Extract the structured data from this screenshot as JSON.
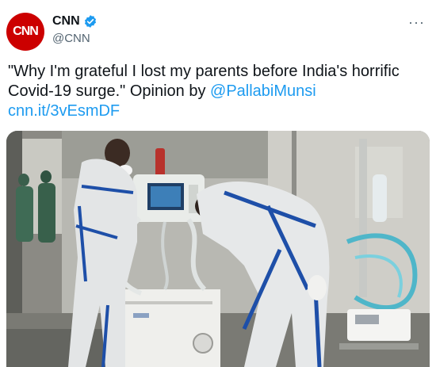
{
  "author": {
    "avatar_text": "CNN",
    "display_name": "CNN",
    "handle": "@CNN",
    "verified_icon": "verified-badge-icon",
    "more_icon": "more-options-icon"
  },
  "tweet": {
    "quote": "\"Why I'm grateful I lost my parents before India's horrific Covid-19 surge.\" Opinion by ",
    "mention": "@PallabiMunsi",
    "short_link": "cnn.it/3vEsmDF"
  },
  "colors": {
    "brand_red": "#cc0000",
    "link_blue": "#1d9bf0",
    "text": "#0f1419",
    "muted": "#536471"
  }
}
